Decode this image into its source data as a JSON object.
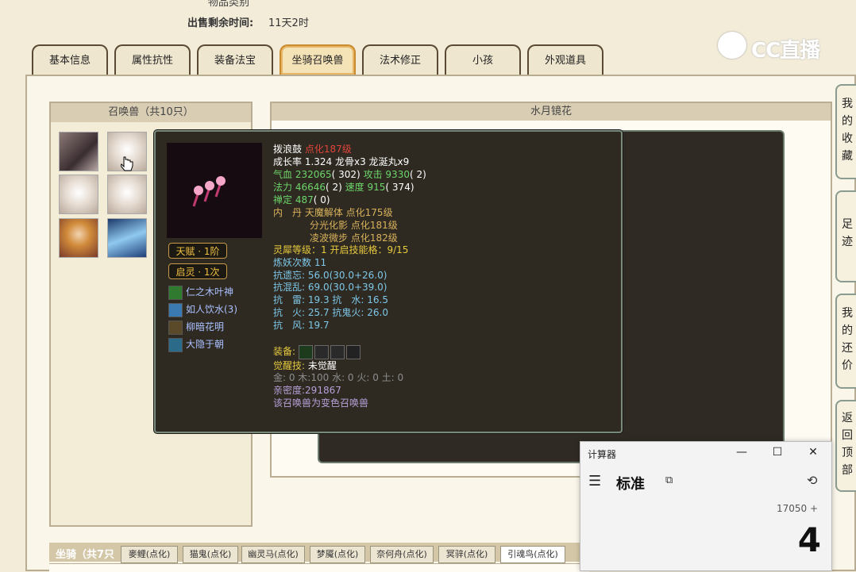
{
  "top": {
    "partial_text": "物品类别",
    "sale_label": "出售剩余时间:",
    "sale_value": "11天2时",
    "logo_text": "CC直播"
  },
  "tabs": [
    {
      "label": "基本信息"
    },
    {
      "label": "属性抗性"
    },
    {
      "label": "装备法宝"
    },
    {
      "label": "坐骑召唤兽"
    },
    {
      "label": "法术修正"
    },
    {
      "label": "小孩"
    },
    {
      "label": "外观道具"
    }
  ],
  "summon_panel": {
    "title": "召唤兽（共10只）"
  },
  "detail_panel": {
    "title": "水月镜花"
  },
  "tooltip": {
    "name": "拨浪鼓",
    "level": "点化187级",
    "growth": "成长率 1.324 龙骨x3 龙涎丸x9",
    "hp_label": "气血",
    "hp_value": "232065",
    "hp_extra": "( 302)",
    "atk_label": "攻击",
    "atk_value": "9330",
    "atk_extra": "( 2)",
    "mp_label": "法力",
    "mp_value": "46646",
    "mp_extra": "( 2)",
    "spd_label": "速度",
    "spd_value": "915",
    "spd_extra": "( 374)",
    "ding_label": "禅定",
    "ding_value": "487",
    "ding_extra": "( 0)",
    "neidan_label": "内　丹",
    "neidan_1": "天魔解体 点化175级",
    "neidan_2": "分光化影 点化181级",
    "neidan_3": "凌波微步 点化182级",
    "lingxi": "灵犀等级：1 开启技能格：9/15",
    "lianyao": "炼妖次数 11",
    "res_1": "抗遗忘: 56.0(30.0+26.0)",
    "res_2": "抗混乱: 69.0(30.0+39.0)",
    "res_3": "抗　雷: 19.3 抗　水: 16.5",
    "res_4": "抗　火: 25.7 抗鬼火: 26.0",
    "res_5": "抗　风: 19.7",
    "equip_label": "装备:",
    "awaken_label": "觉醒技:",
    "awaken_value": "未觉醒",
    "elements": "金: 0 木:100 水: 0 火: 0 土: 0",
    "intimacy": "亲密度:291867",
    "variant": "该召唤兽为变色召唤兽",
    "badge_1": "天赋 · 1阶",
    "badge_2": "启灵 · 1次",
    "skills": [
      "仁之木叶神",
      "如人饮水(3)",
      "柳暗花明",
      "大隐于朝"
    ]
  },
  "bottom": {
    "mount_label": "坐骑（共7只",
    "tabs": [
      "麥鲤(点化)",
      "猫鬼(点化)",
      "幽灵马(点化)",
      "梦魇(点化)",
      "奈何舟(点化)",
      "冥骍(点化)",
      "引魂鸟(点化)"
    ]
  },
  "side_buttons": [
    {
      "chars": [
        "我",
        "的",
        "收",
        "藏"
      ]
    },
    {
      "chars": [
        "足",
        "迹"
      ]
    },
    {
      "chars": [
        "我",
        "的",
        "还",
        "价"
      ]
    },
    {
      "chars": [
        "返",
        "回",
        "顶",
        "部"
      ]
    }
  ],
  "calculator": {
    "title": "计算器",
    "minimize": "—",
    "maximize": "☐",
    "close": "✕",
    "menu": "☰",
    "mode": "标准",
    "keep_on_top": "⧉",
    "history": "⟲",
    "expression": "17050 +",
    "display": "4"
  },
  "colors": {
    "accent": "#c98b2d",
    "tooltip_bg": "#2e2a22",
    "hp_green": "#6dd56a",
    "title_red": "#e0453b"
  }
}
